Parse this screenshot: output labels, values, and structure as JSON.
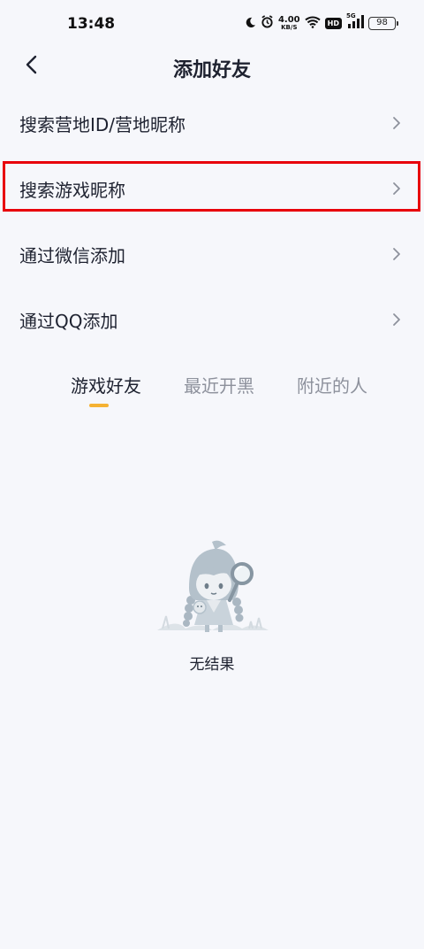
{
  "status_bar": {
    "time": "13:48",
    "net_speed_value": "4.00",
    "net_speed_unit": "KB/S",
    "hd_label": "HD",
    "network_label": "5G",
    "battery": "98"
  },
  "header": {
    "back_icon": "chevron-left-icon",
    "title": "添加好友"
  },
  "menu": {
    "items": [
      {
        "label": "搜索营地ID/营地昵称",
        "icon": "chevron-right-icon"
      },
      {
        "label": "搜索游戏昵称",
        "icon": "chevron-right-icon",
        "highlighted": true
      },
      {
        "label": "通过微信添加",
        "icon": "chevron-right-icon"
      },
      {
        "label": "通过QQ添加",
        "icon": "chevron-right-icon"
      }
    ]
  },
  "tabs": {
    "items": [
      {
        "label": "游戏好友",
        "active": true
      },
      {
        "label": "最近开黑",
        "active": false
      },
      {
        "label": "附近的人",
        "active": false
      }
    ],
    "indicator_color": "#f5b233"
  },
  "empty_state": {
    "illustration": "character-with-magnifier-illustration",
    "text": "无结果"
  },
  "colors": {
    "background": "#f6f7fb",
    "highlight_border": "#e8000b",
    "text_primary": "#1e2230",
    "text_secondary": "#8d919c"
  }
}
